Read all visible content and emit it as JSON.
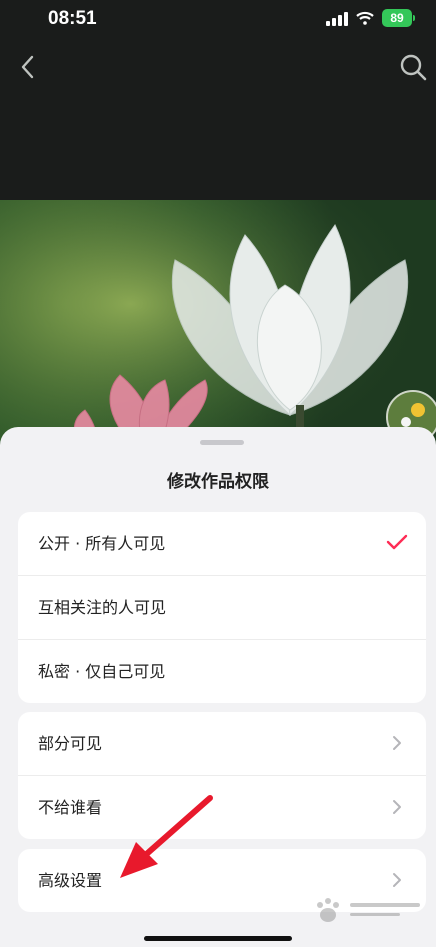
{
  "status_bar": {
    "time": "08:51",
    "battery": "89"
  },
  "sheet": {
    "title": "修改作品权限",
    "group1": [
      {
        "label": "公开 · 所有人可见",
        "selected": true
      },
      {
        "label": "互相关注的人可见",
        "selected": false
      },
      {
        "label": "私密 · 仅自己可见",
        "selected": false
      }
    ],
    "group2": [
      {
        "label": "部分可见"
      },
      {
        "label": "不给谁看"
      }
    ],
    "group3": [
      {
        "label": "高级设置"
      }
    ]
  },
  "colors": {
    "accent": "#fe2c55",
    "sheet_bg": "#f2f2f4",
    "arrow": "#e8192c"
  },
  "icons": [
    "back-icon",
    "search-icon",
    "check-icon",
    "chevron-right-icon",
    "signal-icon",
    "wifi-icon",
    "battery-icon"
  ]
}
